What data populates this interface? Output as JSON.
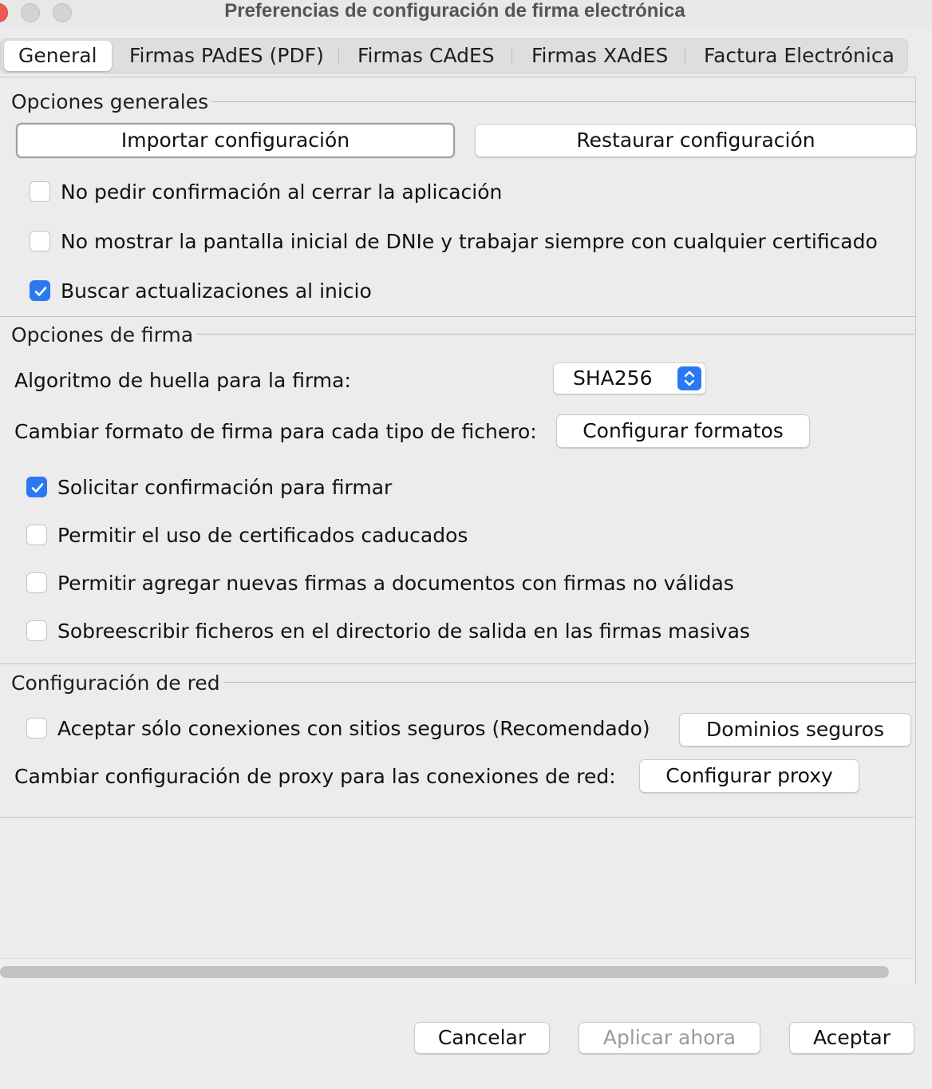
{
  "window": {
    "title": "Preferencias de configuración de firma electrónica"
  },
  "tabs": [
    {
      "label": "General",
      "active": true
    },
    {
      "label": "Firmas PAdES (PDF)"
    },
    {
      "label": "Firmas CAdES"
    },
    {
      "label": "Firmas XAdES"
    },
    {
      "label": "Factura Electrónica"
    }
  ],
  "general_options": {
    "title": "Opciones generales",
    "import_button": "Importar configuración",
    "restore_button": "Restaurar configuración",
    "checkboxes": [
      {
        "label": "No pedir confirmación al cerrar la aplicación",
        "checked": false
      },
      {
        "label": "No mostrar la pantalla inicial de DNIe y trabajar siempre con cualquier certificado",
        "checked": false
      },
      {
        "label": "Buscar actualizaciones al inicio",
        "checked": true
      }
    ]
  },
  "signature_options": {
    "title": "Opciones de firma",
    "algorithm_label": "Algoritmo de huella para la firma:",
    "algorithm_value": "SHA256",
    "format_label": "Cambiar formato de firma para cada tipo de fichero:",
    "format_button": "Configurar formatos",
    "checkboxes": [
      {
        "label": "Solicitar confirmación para firmar",
        "checked": true
      },
      {
        "label": "Permitir el uso de certificados caducados",
        "checked": false
      },
      {
        "label": "Permitir agregar nuevas firmas a documentos con firmas no válidas",
        "checked": false
      },
      {
        "label": "Sobreescribir ficheros en el directorio de salida en las firmas masivas",
        "checked": false
      }
    ]
  },
  "network_options": {
    "title": "Configuración de red",
    "secure_label": "Aceptar sólo conexiones con sitios seguros (Recomendado)",
    "secure_checked": false,
    "domains_button": "Dominios seguros",
    "proxy_label": "Cambiar configuración de proxy para las conexiones de red:",
    "proxy_button": "Configurar proxy"
  },
  "footer": {
    "cancel": "Cancelar",
    "apply": "Aplicar ahora",
    "accept": "Aceptar"
  },
  "colors": {
    "accent": "#2a79f2",
    "close": "#ee5b55"
  }
}
